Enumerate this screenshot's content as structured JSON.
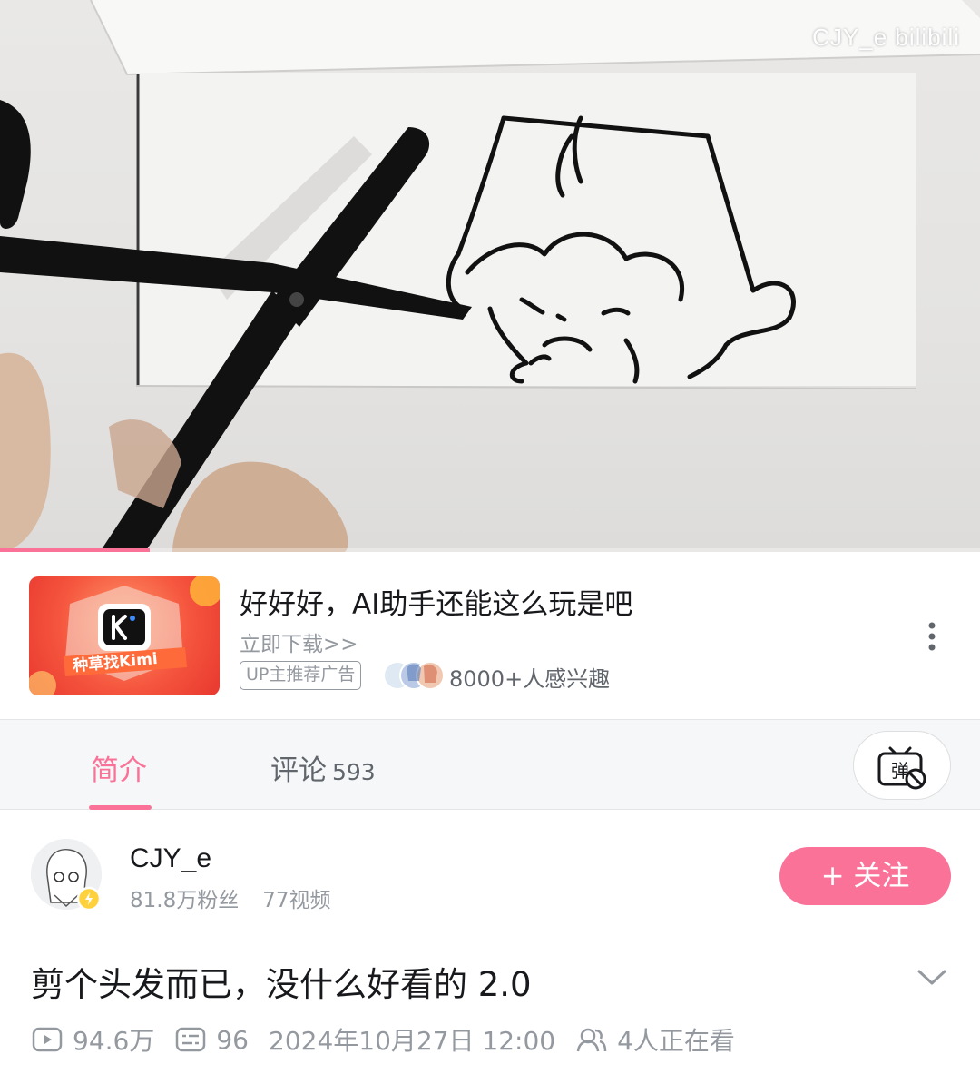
{
  "video": {
    "watermark": "CJY_e bilibili",
    "progress": 0.153
  },
  "ad": {
    "thumb_caption": "种草找Kimi",
    "title": "好好好，AI助手还能这么玩是吧",
    "subtitle": "立即下载>>",
    "badge": "UP主推荐广告",
    "interest": "8000+人感兴趣"
  },
  "tabs": {
    "intro": "简介",
    "comments": "评论",
    "comments_count": "593"
  },
  "uploader": {
    "name": "CJY_e",
    "fans": "81.8万粉丝",
    "videos": "77视频",
    "follow_label": "+ 关注"
  },
  "video_info": {
    "title": "剪个头发而已，没什么好看的 2.0",
    "views": "94.6万",
    "danmaku": "96",
    "date": "2024年10月27日 12:00",
    "watching": "4人正在看"
  },
  "colors": {
    "accent": "#fb7299",
    "text_primary": "#18191c",
    "text_secondary": "#9499a0"
  },
  "icons": [
    "more-vertical-icon",
    "danmaku-off-icon",
    "play-count-icon",
    "danmaku-count-icon",
    "watching-people-icon",
    "chevron-down-icon",
    "verified-badge-icon",
    "kimi-logo-icon"
  ]
}
